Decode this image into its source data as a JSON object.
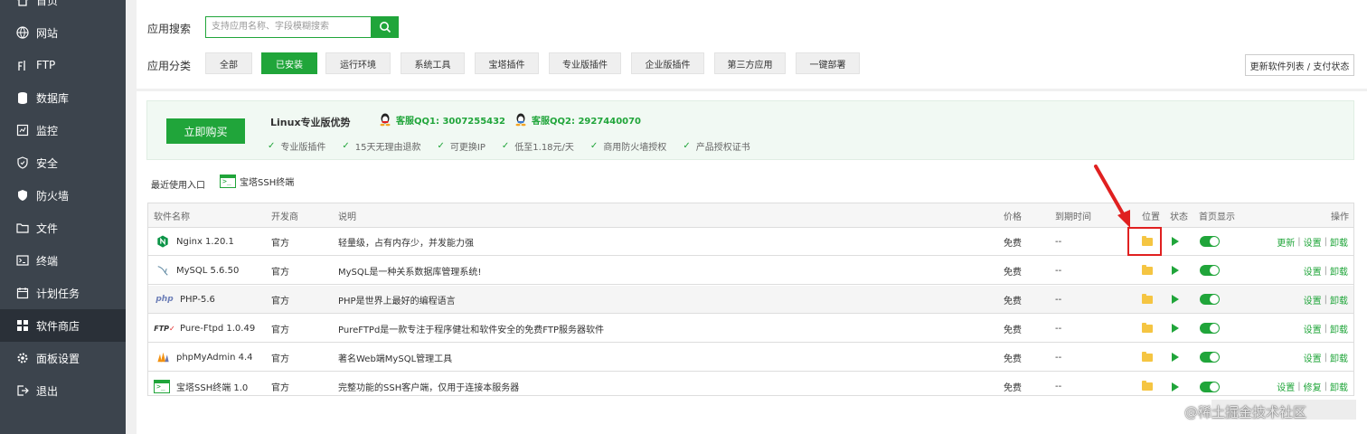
{
  "sidebar": {
    "items": [
      {
        "label": "首页",
        "icon": "home-icon"
      },
      {
        "label": "网站",
        "icon": "globe-icon"
      },
      {
        "label": "FTP",
        "icon": "ftp-icon"
      },
      {
        "label": "数据库",
        "icon": "database-icon"
      },
      {
        "label": "监控",
        "icon": "monitor-icon"
      },
      {
        "label": "安全",
        "icon": "shield-icon"
      },
      {
        "label": "防火墙",
        "icon": "firewall-icon"
      },
      {
        "label": "文件",
        "icon": "folder-icon"
      },
      {
        "label": "终端",
        "icon": "terminal-icon"
      },
      {
        "label": "计划任务",
        "icon": "calendar-icon"
      },
      {
        "label": "软件商店",
        "icon": "grid-icon"
      },
      {
        "label": "面板设置",
        "icon": "gear-icon"
      },
      {
        "label": "退出",
        "icon": "logout-icon"
      }
    ],
    "active_index": 10
  },
  "search": {
    "label": "应用搜索",
    "placeholder": "支持应用名称、字段模糊搜索"
  },
  "category": {
    "label": "应用分类",
    "buttons": [
      "全部",
      "已安装",
      "运行环境",
      "系统工具",
      "宝塔插件",
      "专业版插件",
      "企业版插件",
      "第三方应用",
      "一键部署"
    ],
    "active_index": 1
  },
  "update_button": "更新软件列表 / 支付状态",
  "banner": {
    "buy": "立即购买",
    "title": "Linux专业版优势",
    "qq1": "客服QQ1: 3007255432",
    "qq2": "客服QQ2: 2927440070",
    "features": [
      "专业版插件",
      "15天无理由退款",
      "可更换IP",
      "低至1.18元/天",
      "商用防火墙授权",
      "产品授权证书"
    ]
  },
  "recent": {
    "label": "最近使用入口",
    "item": "宝塔SSH终端"
  },
  "table": {
    "headers": {
      "name": "软件名称",
      "dev": "开发商",
      "desc": "说明",
      "price": "价格",
      "expire": "到期时间",
      "location": "位置",
      "status": "状态",
      "home": "首页显示",
      "ops": "操作"
    },
    "rows": [
      {
        "name": "Nginx 1.20.1",
        "icon": "nginx-icon",
        "dev": "官方",
        "desc": "轻量级，占有内存少，并发能力强",
        "price": "免费",
        "expire": "--",
        "ops": [
          "更新",
          "设置",
          "卸载"
        ]
      },
      {
        "name": "MySQL 5.6.50",
        "icon": "mysql-icon",
        "dev": "官方",
        "desc": "MySQL是一种关系数据库管理系统!",
        "price": "免费",
        "expire": "--",
        "ops": [
          "设置",
          "卸载"
        ]
      },
      {
        "name": "PHP-5.6",
        "icon": "php-icon",
        "dev": "官方",
        "desc": "PHP是世界上最好的编程语言",
        "price": "免费",
        "expire": "--",
        "ops": [
          "设置",
          "卸载"
        ]
      },
      {
        "name": "Pure-Ftpd 1.0.49",
        "icon": "ftp-icon",
        "dev": "官方",
        "desc": "PureFTPd是一款专注于程序健壮和软件安全的免费FTP服务器软件",
        "price": "免费",
        "expire": "--",
        "ops": [
          "设置",
          "卸载"
        ]
      },
      {
        "name": "phpMyAdmin 4.4",
        "icon": "phpmyadmin-icon",
        "dev": "官方",
        "desc": "著名Web端MySQL管理工具",
        "price": "免费",
        "expire": "--",
        "ops": [
          "设置",
          "卸载"
        ]
      },
      {
        "name": "宝塔SSH终端 1.0",
        "icon": "terminal-icon",
        "dev": "官方",
        "desc": "完整功能的SSH客户端，仅用于连接本服务器",
        "price": "免费",
        "expire": "--",
        "ops": [
          "设置",
          "修复",
          "卸载"
        ]
      }
    ]
  },
  "watermark": "@稀土掘金技术社区",
  "colors": {
    "accent": "#20a53a",
    "sidebar": "#3c444d",
    "highlight": "#e02020"
  }
}
